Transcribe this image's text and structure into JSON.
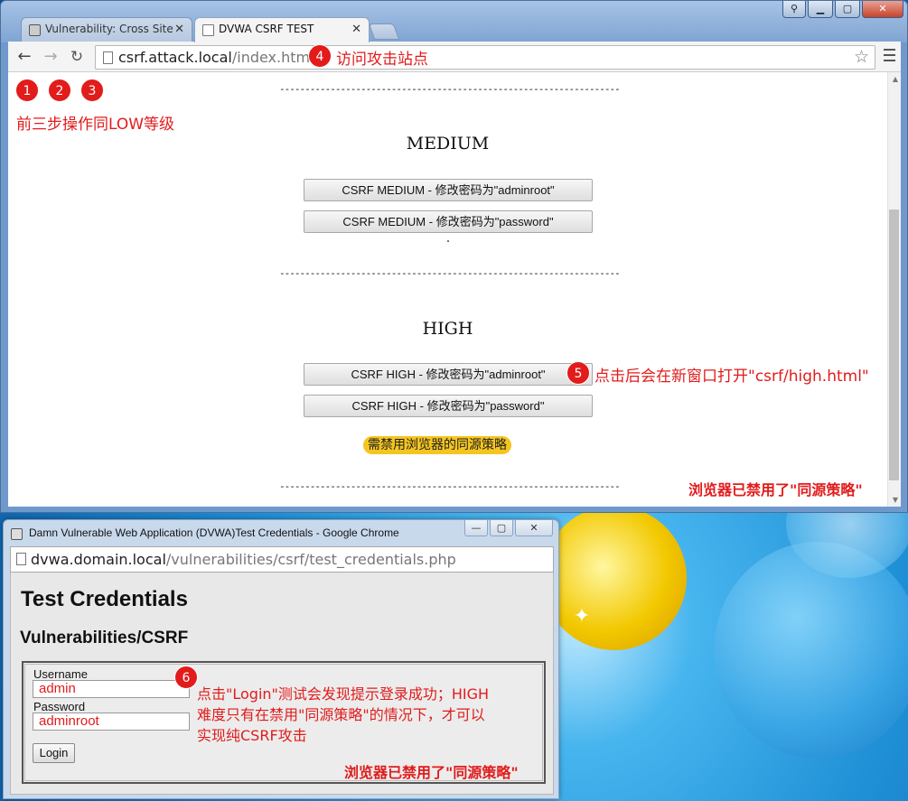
{
  "browser": {
    "tabs": [
      {
        "title": "Vulnerability: Cross Site"
      },
      {
        "title": "DVWA CSRF TEST"
      }
    ],
    "url_host": "csrf.attack.local",
    "url_path": "/index.html",
    "window_controls": {
      "user": "⚲",
      "minimize": "▁",
      "maximize": "▢",
      "close": "✕"
    }
  },
  "page": {
    "divider": "----------------------------------------------------------------------",
    "medium": {
      "title": "MEDIUM",
      "buttons": [
        "CSRF MEDIUM - 修改密码为\"adminroot\"",
        "CSRF MEDIUM - 修改密码为\"password\""
      ]
    },
    "high": {
      "title": "HIGH",
      "buttons": [
        "CSRF HIGH - 修改密码为\"adminroot\"",
        "CSRF HIGH - 修改密码为\"password\""
      ]
    },
    "same_origin_tag": "需禁用浏览器的同源策略"
  },
  "annotations": {
    "step_numbers": [
      "1",
      "2",
      "3",
      "4",
      "5",
      "6"
    ],
    "steps_123_note": "前三步操作同LOW等级",
    "step4_note": "访问攻击站点",
    "step5_note": "点击后会在新窗口打开\"csrf/high.html\"",
    "sop_disabled": "浏览器已禁用了\"同源策略\"",
    "step6_lines": [
      "点击\"Login\"测试会发现提示登录成功；HIGH",
      "难度只有在禁用\"同源策略\"的情况下，才可以",
      "实现纯CSRF攻击"
    ]
  },
  "popup": {
    "title": "Damn Vulnerable Web Application (DVWA)Test Credentials - Google Chrome",
    "url_host": "dvwa.domain.local",
    "url_path": "/vulnerabilities/csrf/test_credentials.php",
    "heading": "Test Credentials",
    "subheading": "Vulnerabilities/CSRF",
    "username_label": "Username",
    "username_value": "admin",
    "password_label": "Password",
    "password_value": "adminroot",
    "login_label": "Login",
    "controls": {
      "minimize": "—",
      "maximize": "▢",
      "close": "✕"
    }
  },
  "colors": {
    "annotation_red": "#e21b1b",
    "tag_yellow": "#f5c51f"
  }
}
